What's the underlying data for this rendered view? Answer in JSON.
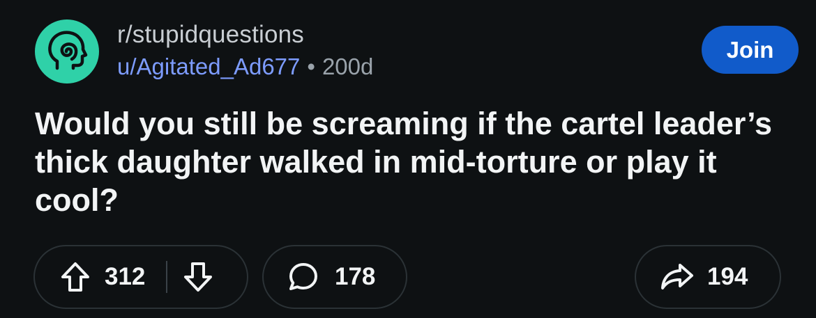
{
  "post": {
    "subreddit": "r/stupidquestions",
    "username": "u/Agitated_Ad677",
    "separator": "•",
    "age": "200d",
    "join_label": "Join",
    "title": "Would you still be screaming if the cartel leader’s thick daughter walked in mid-torture or play it cool?",
    "upvotes": "312",
    "comments": "178",
    "shares": "194"
  },
  "icons": {
    "avatar": "subreddit-avatar-icon",
    "upvote": "upvote-arrow-icon",
    "downvote": "downvote-arrow-icon",
    "comment": "comment-bubble-icon",
    "share": "share-arrow-icon"
  },
  "colors": {
    "background": "#0e1113",
    "avatar": "#2fd1a8",
    "username": "#7d9cff",
    "join_button": "#115bca",
    "pill_border": "#2b3236"
  }
}
